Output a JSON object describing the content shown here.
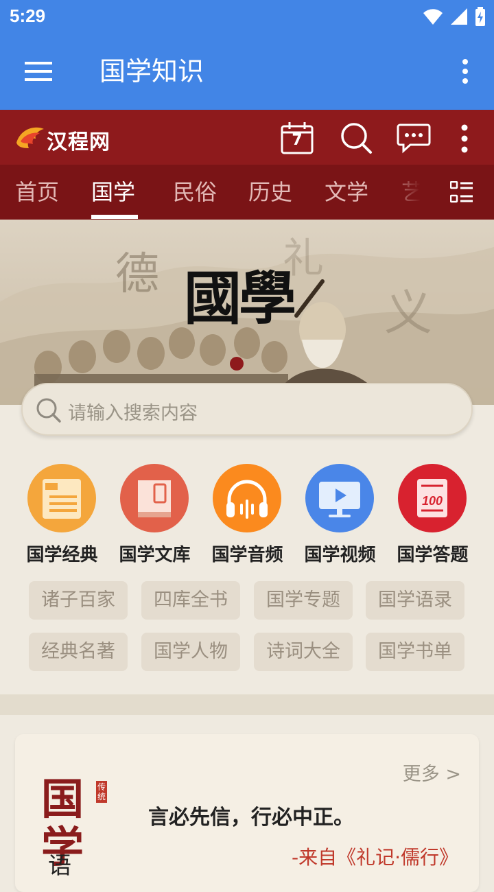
{
  "status": {
    "time": "5:29"
  },
  "app_bar": {
    "title": "国学知识"
  },
  "site": {
    "logo_text": "汉程网",
    "calendar_day": "7"
  },
  "tabs": [
    {
      "label": "首页"
    },
    {
      "label": "国学"
    },
    {
      "label": "民俗"
    },
    {
      "label": "历史"
    },
    {
      "label": "文学"
    },
    {
      "label": "艺术"
    }
  ],
  "banner": {
    "calligraphy": "國學",
    "bg_chars": [
      "德",
      "礼",
      "义"
    ]
  },
  "search": {
    "placeholder": "请输入搜索内容"
  },
  "categories": [
    {
      "label": "国学经典",
      "color": "#f4a63c",
      "icon": "document-icon"
    },
    {
      "label": "国学文库",
      "color": "#e2614a",
      "icon": "book-icon"
    },
    {
      "label": "国学音频",
      "color": "#fb8a1e",
      "icon": "headphones-icon"
    },
    {
      "label": "国学视频",
      "color": "#4a86e8",
      "icon": "video-icon"
    },
    {
      "label": "国学答题",
      "color": "#d8222f",
      "icon": "exam-icon"
    }
  ],
  "tags": [
    {
      "label": "诸子百家"
    },
    {
      "label": "四库全书"
    },
    {
      "label": "国学专题"
    },
    {
      "label": "国学语录"
    },
    {
      "label": "经典名著"
    },
    {
      "label": "国学人物"
    },
    {
      "label": "诗词大全"
    },
    {
      "label": "国学书单"
    }
  ],
  "quote": {
    "more": "更多 >",
    "text": "言必先信，行必中正。",
    "source": "-来自《礼记·儒行》",
    "art_main": "国学",
    "art_sub": "语",
    "art_seal": "传统"
  },
  "colors": {
    "primary_blue": "#4285e6",
    "header_red": "#8e1a1c",
    "tab_red": "#7a1416"
  }
}
